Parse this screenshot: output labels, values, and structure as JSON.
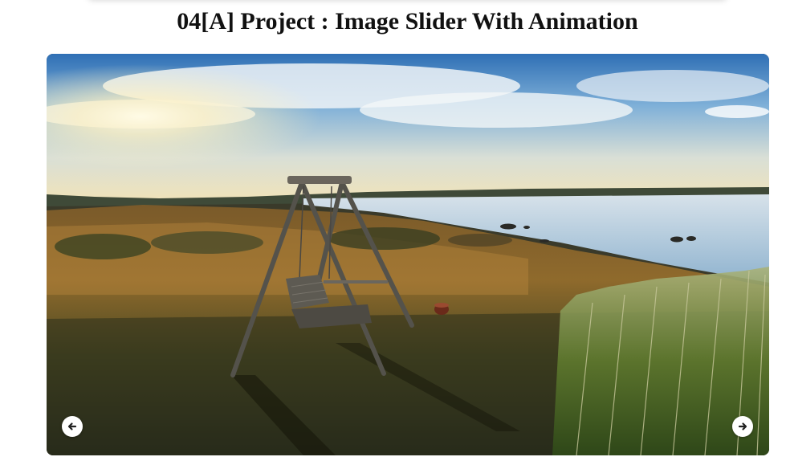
{
  "header": {
    "title": "04[A] Project : Image Slider With Animation"
  },
  "slider": {
    "image_alt": "Wooden porch swing on a grassy hill overlooking a calm lake at sunset",
    "prev_icon": "arrow-left-icon",
    "next_icon": "arrow-right-icon"
  },
  "colors": {
    "title": "#111111",
    "button_bg": "#ffffff",
    "button_icon": "#222222"
  }
}
